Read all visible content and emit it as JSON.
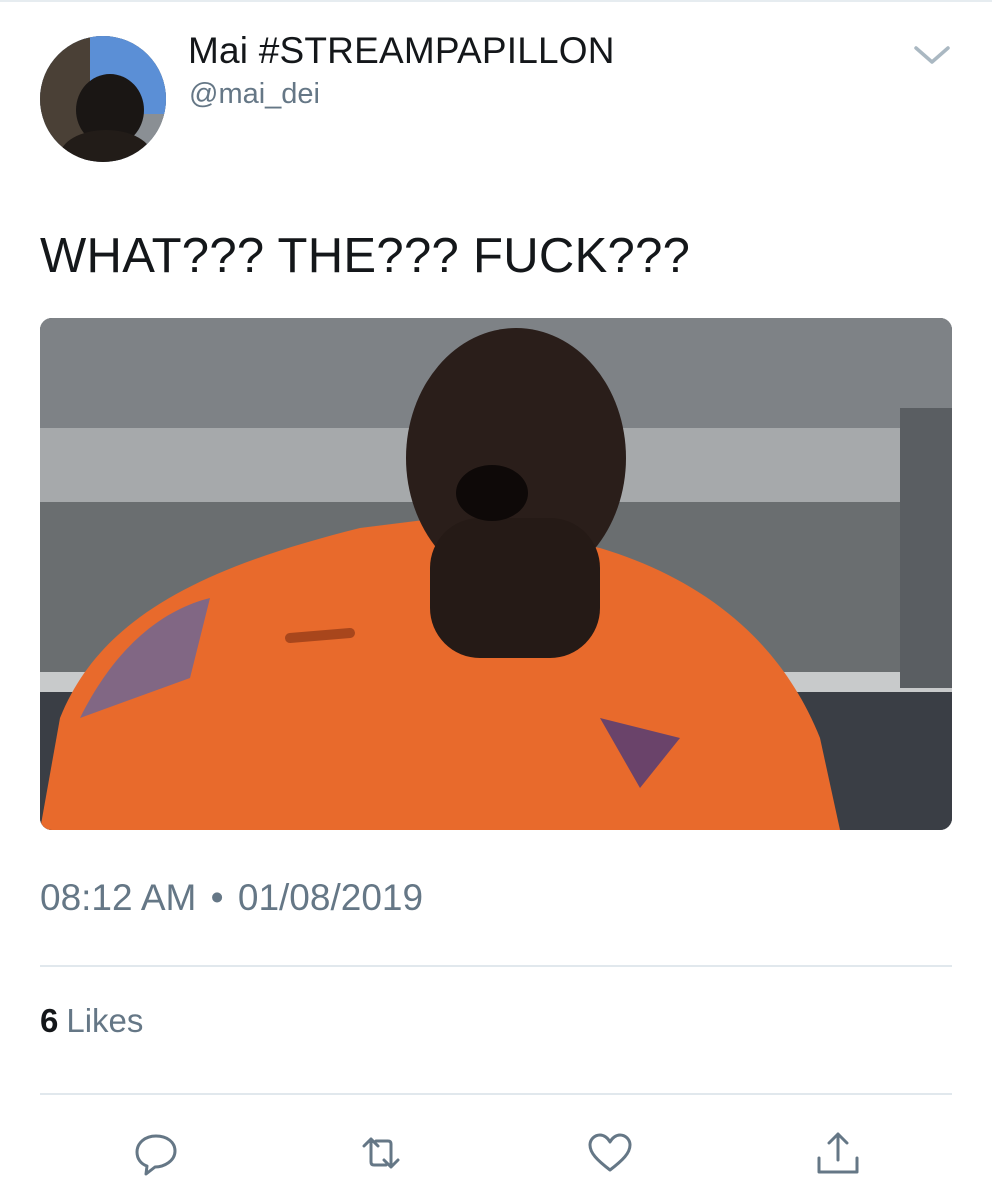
{
  "user": {
    "display_name": "Mai #STREAMPAPILLON",
    "handle": "@mai_dei",
    "avatar_icon": "profile-avatar"
  },
  "tweet": {
    "text": "WHAT??? THE??? FUCK???",
    "time": "08:12 AM",
    "separator": "•",
    "date": "01/08/2019",
    "likes_count": "6",
    "likes_label": "Likes"
  },
  "media": {
    "description_icon": "attached-photo"
  },
  "actions": {
    "reply_icon": "reply-icon",
    "retweet_icon": "retweet-icon",
    "like_icon": "heart-icon",
    "share_icon": "share-icon"
  },
  "colors": {
    "text_primary": "#14171a",
    "text_secondary": "#657786",
    "divider": "#e1e8ed",
    "icon": "#657786"
  }
}
